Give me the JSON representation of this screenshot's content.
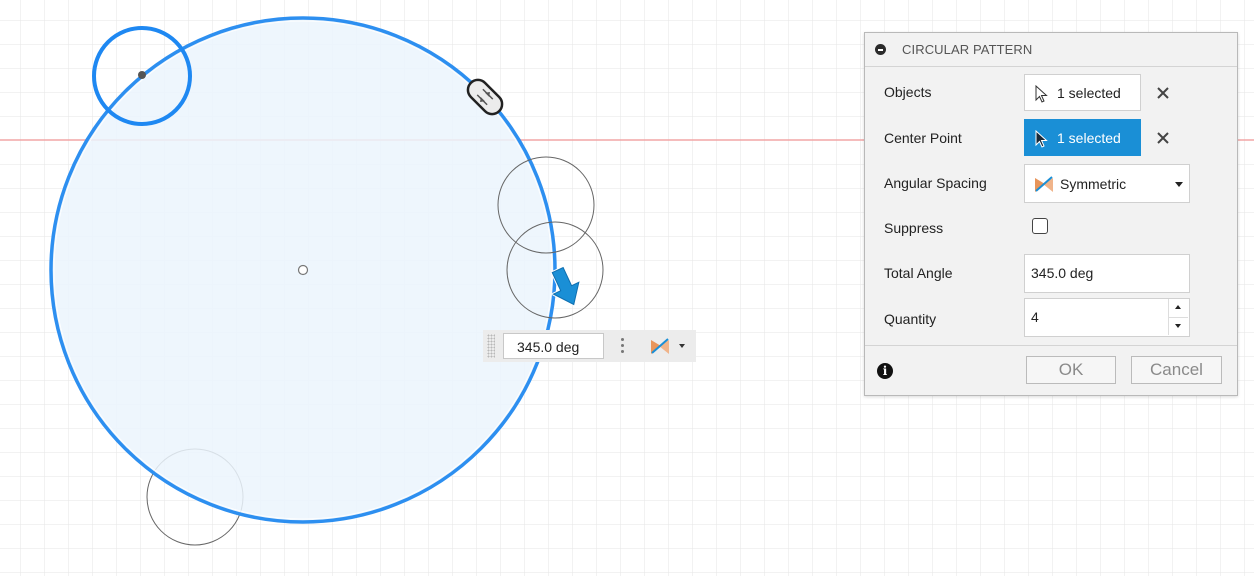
{
  "panel": {
    "title": "CIRCULAR PATTERN",
    "objects": {
      "label": "Objects",
      "value": "1 selected"
    },
    "center_point": {
      "label": "Center Point",
      "value": "1 selected"
    },
    "angular_spacing": {
      "label": "Angular Spacing",
      "value": "Symmetric"
    },
    "suppress": {
      "label": "Suppress",
      "checked": false
    },
    "total_angle": {
      "label": "Total Angle",
      "value": "345.0 deg"
    },
    "quantity": {
      "label": "Quantity",
      "value": "4"
    },
    "ok_label": "OK",
    "cancel_label": "Cancel"
  },
  "mini_toolbar": {
    "angle_value": "345.0 deg"
  },
  "colors": {
    "accent": "#1a8fd6",
    "sketch_blue": "#2d8ff0",
    "fill_blue": "#ebf4fd",
    "axis_red": "#f2a5a5",
    "grid": "#e6e6e6",
    "symmetric_icon": "#e8955a"
  },
  "icons": {
    "cursor": "cursor-arrow-icon",
    "clear": "close-x-icon",
    "symmetric": "symmetric-spacing-icon",
    "info": "info-icon",
    "collapse": "collapse-minus-icon",
    "drag_arrow": "drag-arrow-icon",
    "rotate_handle": "rotate-handle-icon"
  }
}
